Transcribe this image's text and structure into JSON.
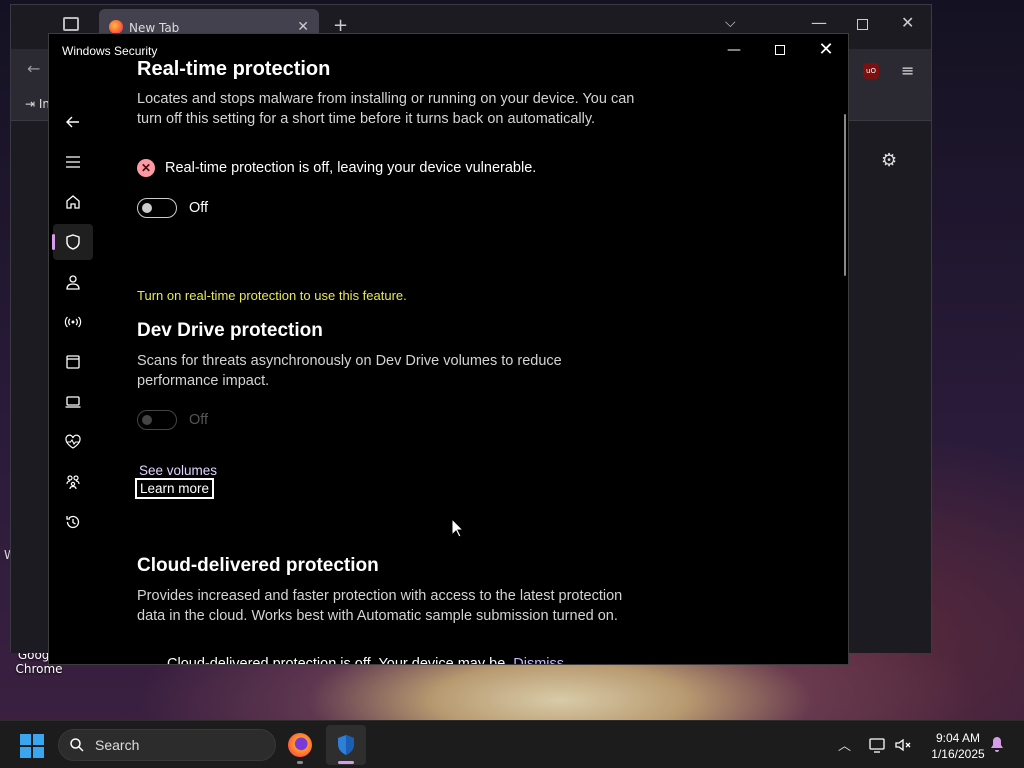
{
  "desktop": {
    "chrome_icon_label": "Google Chrome"
  },
  "browser": {
    "tab_title": "New Tab",
    "bookmark_import_label": "Im",
    "ublock_badge": "uO"
  },
  "window": {
    "title": "Windows Security"
  },
  "realtime": {
    "heading": "Real-time protection",
    "description": "Locates and stops malware from installing or running on your device. You can turn off this setting for a short time before it turns back on automatically.",
    "status_text": "Real-time protection is off, leaving your device vulnerable.",
    "toggle_label": "Off",
    "toggle_on": false
  },
  "devdrive": {
    "notice": "Turn on real-time protection to use this feature.",
    "heading": "Dev Drive protection",
    "description": "Scans for threats asynchronously on Dev Drive volumes to reduce performance impact.",
    "toggle_label": "Off",
    "toggle_on": false,
    "toggle_disabled": true,
    "see_volumes": "See volumes",
    "learn_more": "Learn more"
  },
  "cloud": {
    "heading": "Cloud-delivered protection",
    "description": "Provides increased and faster protection with access to the latest protection data in the cloud. Works best with Automatic sample submission turned on.",
    "status_text": "Cloud-delivered protection is off. Your device may be",
    "dismiss": "Dismiss"
  },
  "nav": {
    "items": [
      {
        "name": "back",
        "icon": "back-arrow-icon"
      },
      {
        "name": "menu",
        "icon": "hamburger-icon"
      },
      {
        "name": "home",
        "icon": "home-icon"
      },
      {
        "name": "virus-threat-protection",
        "icon": "shield-icon",
        "active": true
      },
      {
        "name": "account-protection",
        "icon": "person-icon"
      },
      {
        "name": "firewall-network",
        "icon": "antenna-icon"
      },
      {
        "name": "app-browser-control",
        "icon": "browser-window-icon"
      },
      {
        "name": "device-security",
        "icon": "laptop-icon"
      },
      {
        "name": "device-performance-health",
        "icon": "heart-pulse-icon"
      },
      {
        "name": "family-options",
        "icon": "family-icon"
      },
      {
        "name": "protection-history",
        "icon": "history-icon"
      },
      {
        "name": "settings",
        "icon": "gear-icon"
      }
    ]
  },
  "taskbar": {
    "search_placeholder": "Search",
    "time": "9:04 AM",
    "date": "1/16/2025"
  },
  "colors": {
    "accent": "#d59ce8",
    "warning_text": "#e8e85a",
    "error_icon": "#ff99a4",
    "link": "#e0d2ff"
  }
}
